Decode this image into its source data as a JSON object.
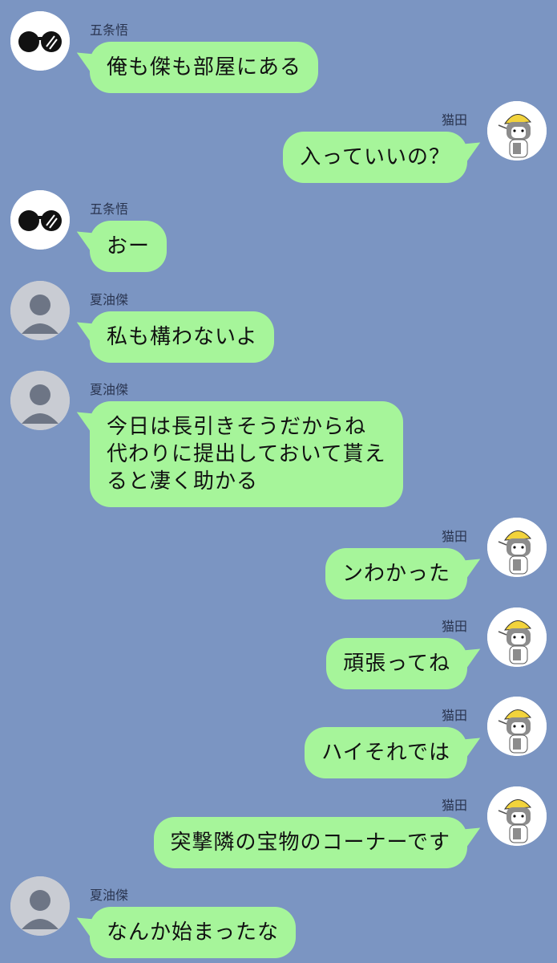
{
  "chat": {
    "messages": [
      {
        "side": "left",
        "sender": "五条悟",
        "avatar": "sunglasses-icon",
        "text": "俺も傑も部屋にある"
      },
      {
        "side": "right",
        "sender": "猫田",
        "avatar": "cat-worker-icon",
        "text": "入っていいの？"
      },
      {
        "side": "left",
        "sender": "五条悟",
        "avatar": "sunglasses-icon",
        "text": "おー"
      },
      {
        "side": "left",
        "sender": "夏油傑",
        "avatar": "default-user-icon",
        "text": "私も構わないよ"
      },
      {
        "side": "left",
        "sender": "夏油傑",
        "avatar": "default-user-icon",
        "text": "今日は長引きそうだからね\n代わりに提出しておいて貰え\nると凄く助かる"
      },
      {
        "side": "right",
        "sender": "猫田",
        "avatar": "cat-worker-icon",
        "text": "ンわかった"
      },
      {
        "side": "right",
        "sender": "猫田",
        "avatar": "cat-worker-icon",
        "text": "頑張ってね"
      },
      {
        "side": "right",
        "sender": "猫田",
        "avatar": "cat-worker-icon",
        "text": "ハイそれでは"
      },
      {
        "side": "right",
        "sender": "猫田",
        "avatar": "cat-worker-icon",
        "text": "突撃隣の宝物のコーナーです"
      },
      {
        "side": "left",
        "sender": "夏油傑",
        "avatar": "default-user-icon",
        "text": "なんか始まったな"
      }
    ]
  },
  "colors": {
    "background": "#7b95c2",
    "bubble": "#a6f59a",
    "sender_name": "#2a3550"
  }
}
